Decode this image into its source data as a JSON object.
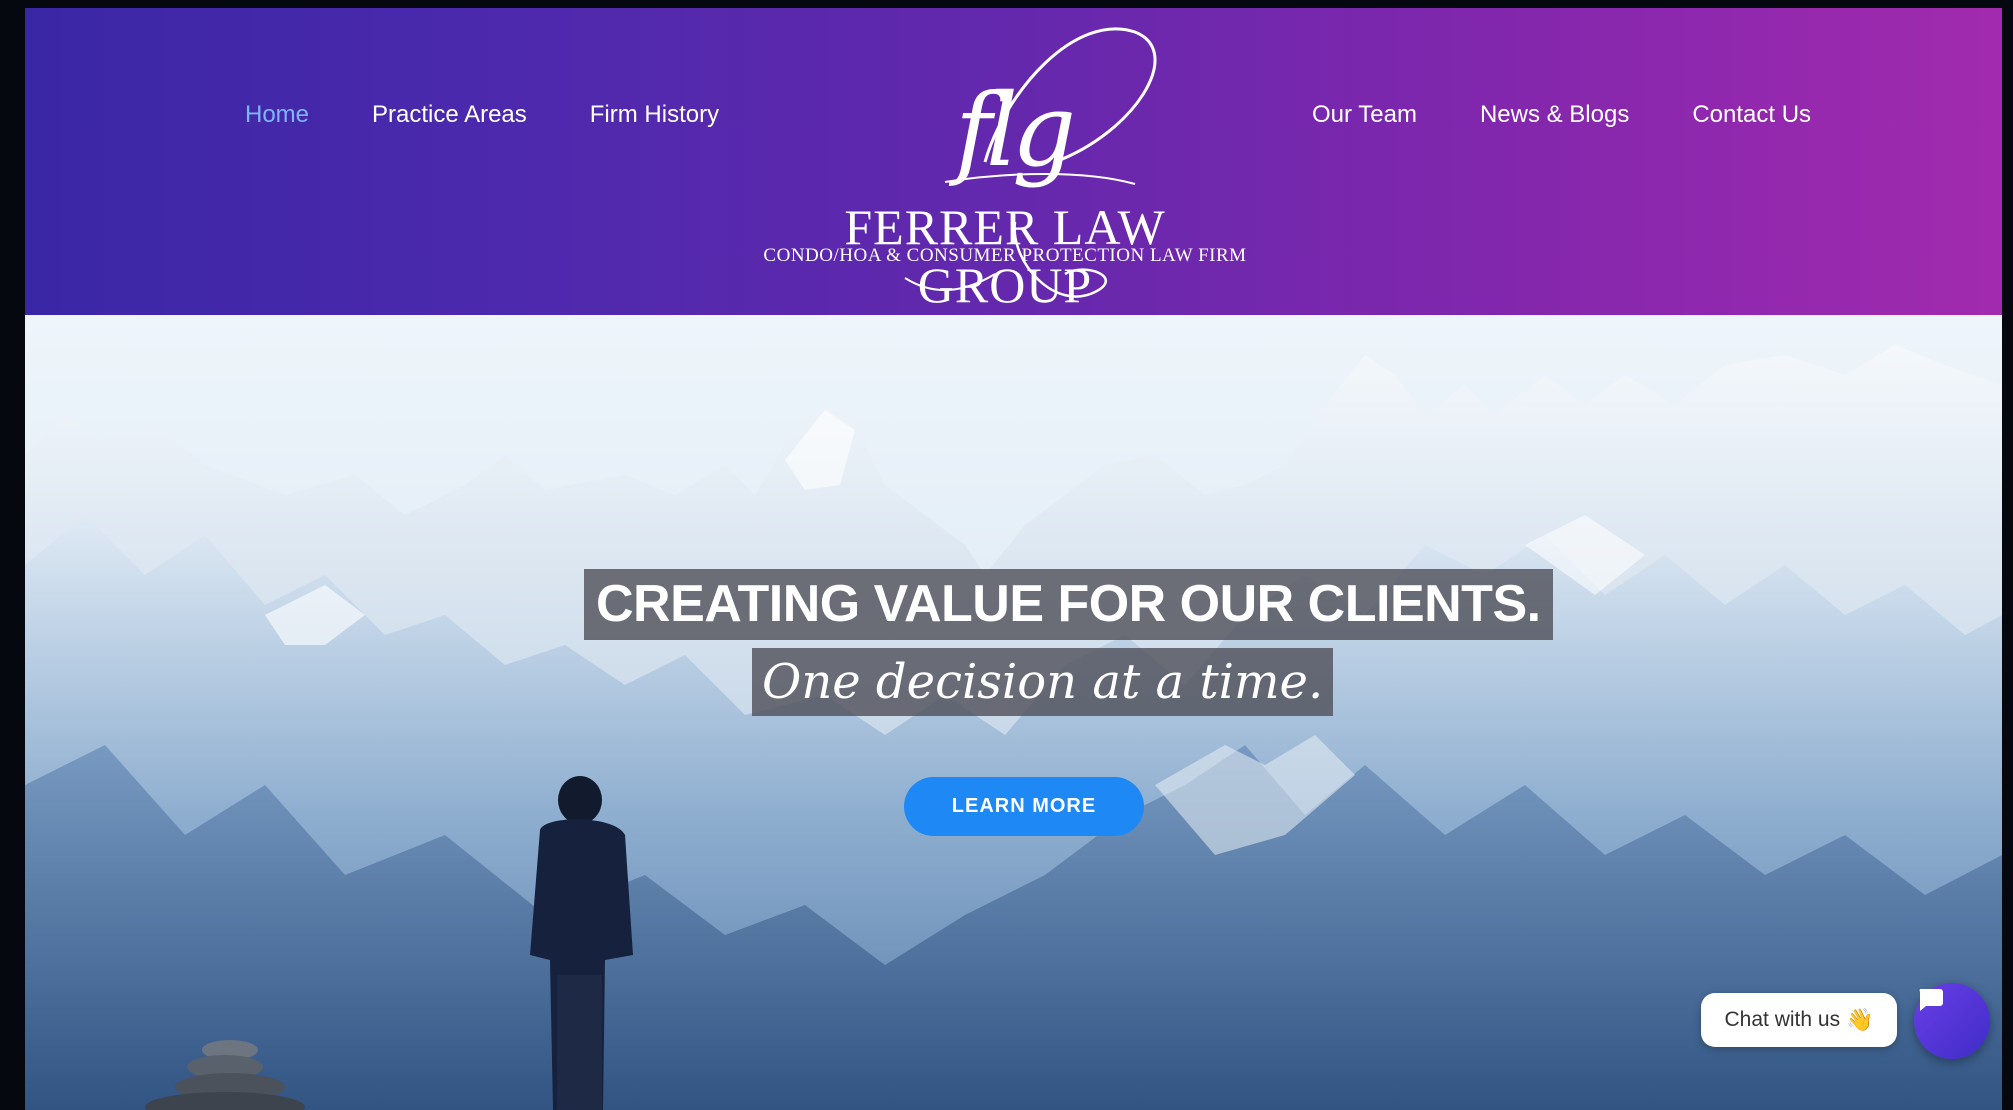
{
  "nav": {
    "left": [
      "Home",
      "Practice Areas",
      "Firm History"
    ],
    "right": [
      "Our Team",
      "News & Blogs",
      "Contact Us"
    ],
    "active": "Home"
  },
  "logo": {
    "mark": "flg",
    "name": "FERRER LAW GROUP",
    "tagline": "CONDO/HOA & CONSUMER PROTECTION LAW FIRM"
  },
  "hero": {
    "headline": "CREATING VALUE FOR OUR CLIENTS.",
    "subheadline": "One decision at a time.",
    "cta_label": "LEARN MORE"
  },
  "chat": {
    "label": "Chat with us",
    "emoji": "👋",
    "button_icon": "chat-bubble-icon"
  },
  "colors": {
    "header_gradient_start": "#3a27a6",
    "header_gradient_end": "#a22aae",
    "active_link": "#7fb4ff",
    "cta": "#1e88f5"
  }
}
